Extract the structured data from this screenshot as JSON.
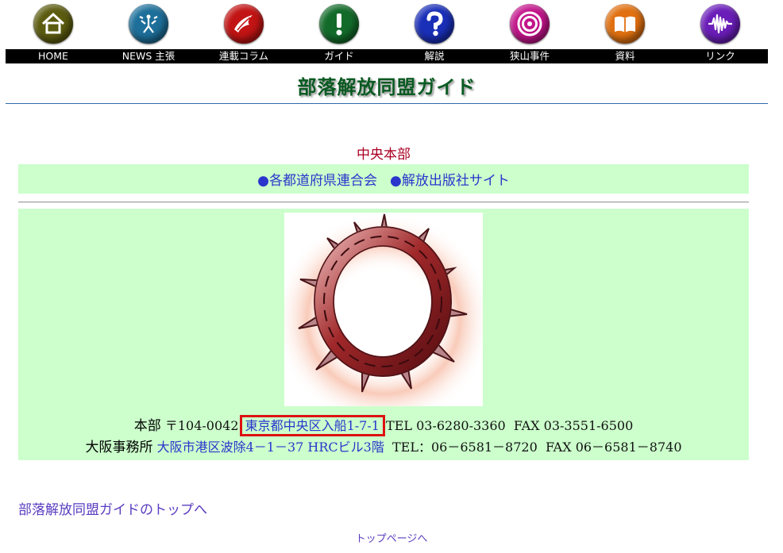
{
  "nav": {
    "items": [
      {
        "label": "HOME",
        "icon": "home-icon",
        "color": "#5c5c10"
      },
      {
        "label": "NEWS 主張",
        "icon": "news-icon",
        "color": "#1d6f9a"
      },
      {
        "label": "連載コラム",
        "icon": "column-icon",
        "color": "#c21414"
      },
      {
        "label": "ガイド",
        "icon": "exclamation-icon",
        "color": "#136b2a"
      },
      {
        "label": "解説",
        "icon": "question-icon",
        "color": "#1a2fb8"
      },
      {
        "label": "狭山事件",
        "icon": "target-icon",
        "color": "#c2148a"
      },
      {
        "label": "資料",
        "icon": "book-icon",
        "color": "#e07010"
      },
      {
        "label": "リンク",
        "icon": "wave-icon",
        "color": "#6a1db8"
      }
    ]
  },
  "page": {
    "title": "部落解放同盟ガイド",
    "section_heading": "中央本部"
  },
  "links": {
    "federations": "●各都道府県連合会",
    "publisher": "●解放出版社サイト"
  },
  "headquarters": {
    "label": "本部",
    "postal": "〒104-0042",
    "address": "東京都中央区入船1-7-1",
    "tel": "TEL 03-6280-3360",
    "fax": "FAX 03-3551-6500"
  },
  "osaka": {
    "label": "大阪事務所",
    "address": "大阪市港区波除4－1－37 HRCビル3階",
    "tel": "TEL：06－6581－8720",
    "fax": "FAX 06－6581－8740"
  },
  "footer": {
    "back_link": "部落解放同盟ガイドのトップへ",
    "top_link": "トップページへ"
  },
  "colors": {
    "nav_bar": "#000000",
    "title_green": "#0a5a22",
    "box_bg": "#ccffcc",
    "heading_red": "#aa0022",
    "link_blue": "#2b35cc",
    "highlight": "#dd1111"
  }
}
